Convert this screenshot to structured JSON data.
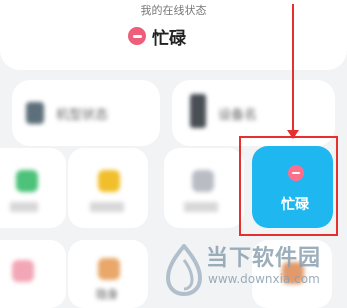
{
  "status_section": {
    "title": "我的在线状态",
    "current_status": "忙碌",
    "status_color": "#ee5d79"
  },
  "top_options": [
    {
      "icon": "phone-icon",
      "label": "机型状态"
    },
    {
      "icon": "device-icon",
      "label": "设备名"
    }
  ],
  "status_options": [
    {
      "icon": "status-icon",
      "label": ""
    },
    {
      "icon": "status-icon",
      "label": ""
    },
    {
      "icon": "status-icon",
      "label": ""
    },
    {
      "icon": "busy-icon",
      "label": "忙碌",
      "selected": true
    }
  ],
  "bottom_options": [
    {
      "icon": "status-icon",
      "label": ""
    },
    {
      "icon": "status-icon",
      "label": "隐身"
    },
    {
      "icon": "status-icon",
      "label": ""
    },
    {
      "icon": "status-icon",
      "label": ""
    }
  ],
  "watermark": {
    "text": "当下软件园",
    "url": "www.downxia.com"
  },
  "colors": {
    "accent": "#1fb7f0",
    "highlight": "#e63030"
  }
}
